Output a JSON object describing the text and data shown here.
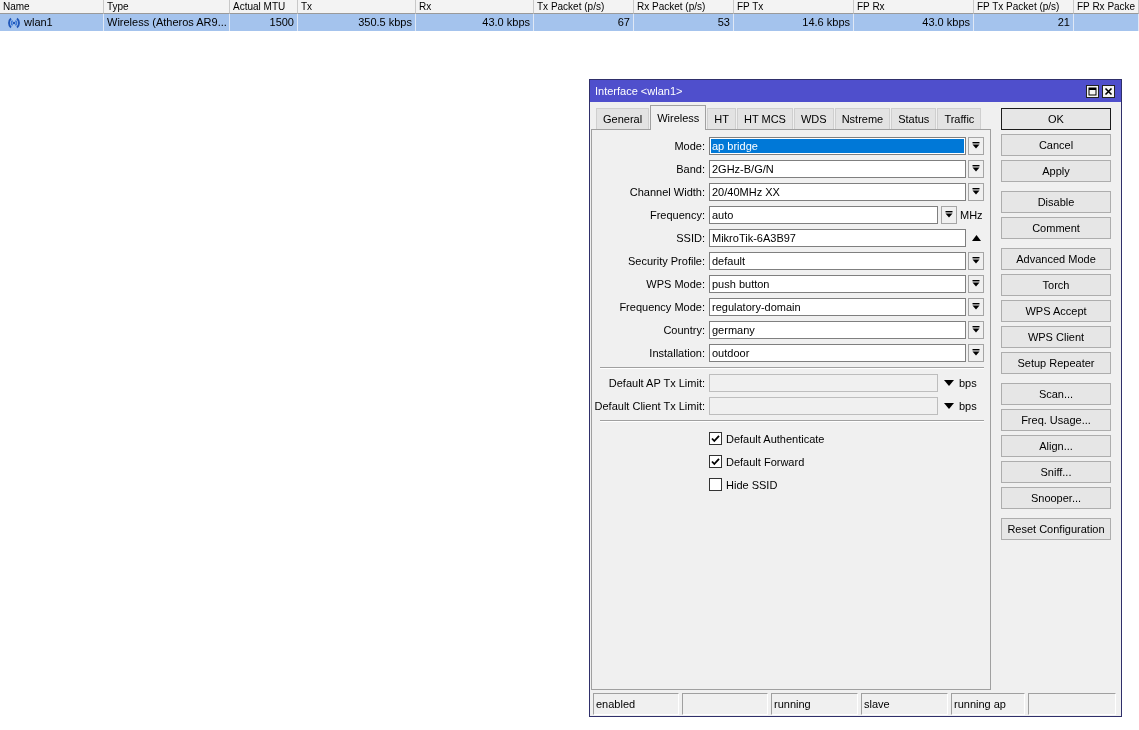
{
  "interface_table": {
    "columns": [
      "Name",
      "Type",
      "Actual MTU",
      "Tx",
      "Rx",
      "Tx Packet (p/s)",
      "Rx Packet (p/s)",
      "FP Tx",
      "FP Rx",
      "FP Tx Packet (p/s)",
      "FP Rx Packe"
    ],
    "rows": [
      {
        "selected": true,
        "cells": [
          "wlan1",
          "Wireless (Atheros AR9...",
          "1500",
          "350.5 kbps",
          "43.0 kbps",
          "67",
          "53",
          "14.6 kbps",
          "43.0 kbps",
          "21"
        ]
      }
    ]
  },
  "dialog": {
    "title": "Interface <wlan1>",
    "tabs": [
      {
        "label": "General",
        "selected": false
      },
      {
        "label": "Wireless",
        "selected": true
      },
      {
        "label": "HT",
        "selected": false
      },
      {
        "label": "HT MCS",
        "selected": false
      },
      {
        "label": "WDS",
        "selected": false
      },
      {
        "label": "Nstreme",
        "selected": false
      },
      {
        "label": "Status",
        "selected": false
      },
      {
        "label": "Traffic",
        "selected": false
      }
    ],
    "fields": [
      {
        "label": "Mode:",
        "value": "ap bridge",
        "kind": "dropdown",
        "highlighted": true
      },
      {
        "label": "Band:",
        "value": "2GHz-B/G/N",
        "kind": "dropdown",
        "highlighted": false
      },
      {
        "label": "Channel Width:",
        "value": "20/40MHz XX",
        "kind": "dropdown",
        "highlighted": false
      },
      {
        "label": "Frequency:",
        "value": "auto",
        "kind": "dropdown-unit",
        "unit": "MHz",
        "highlighted": false
      },
      {
        "label": "SSID:",
        "value": "MikroTik-6A3B97",
        "kind": "text-toggle",
        "highlighted": false
      },
      {
        "label": "Security Profile:",
        "value": "default",
        "kind": "dropdown",
        "highlighted": false
      },
      {
        "label": "WPS Mode:",
        "value": "push button",
        "kind": "dropdown",
        "highlighted": false
      },
      {
        "label": "Frequency Mode:",
        "value": "regulatory-domain",
        "kind": "dropdown",
        "highlighted": false
      },
      {
        "label": "Country:",
        "value": "germany",
        "kind": "dropdown",
        "highlighted": false
      },
      {
        "label": "Installation:",
        "value": "outdoor",
        "kind": "dropdown",
        "highlighted": false
      }
    ],
    "limits": [
      {
        "label": "Default AP Tx Limit:",
        "unit": "bps",
        "disabled": true
      },
      {
        "label": "Default Client Tx Limit:",
        "unit": "bps",
        "disabled": true
      }
    ],
    "checkboxes": [
      {
        "label": "Default Authenticate",
        "checked": true
      },
      {
        "label": "Default Forward",
        "checked": true
      },
      {
        "label": "Hide SSID",
        "checked": false
      }
    ],
    "button_groups": [
      [
        {
          "label": "OK",
          "default": true
        },
        {
          "label": "Cancel",
          "default": false
        },
        {
          "label": "Apply",
          "default": false
        }
      ],
      [
        {
          "label": "Disable",
          "default": false
        },
        {
          "label": "Comment",
          "default": false
        }
      ],
      [
        {
          "label": "Advanced Mode",
          "default": false
        },
        {
          "label": "Torch",
          "default": false
        },
        {
          "label": "WPS Accept",
          "default": false
        },
        {
          "label": "WPS Client",
          "default": false
        },
        {
          "label": "Setup Repeater",
          "default": false
        }
      ],
      [
        {
          "label": "Scan...",
          "default": false
        },
        {
          "label": "Freq. Usage...",
          "default": false
        },
        {
          "label": "Align...",
          "default": false
        },
        {
          "label": "Sniff...",
          "default": false
        },
        {
          "label": "Snooper...",
          "default": false
        }
      ],
      [
        {
          "label": "Reset Configuration",
          "default": false
        }
      ]
    ],
    "status_bar": [
      {
        "kind": "text",
        "text": "enabled"
      },
      {
        "kind": "blank"
      },
      {
        "kind": "text",
        "text": "running"
      },
      {
        "kind": "text",
        "text": "slave"
      },
      {
        "kind": "text",
        "text": "running ap"
      },
      {
        "kind": "blank"
      }
    ]
  }
}
